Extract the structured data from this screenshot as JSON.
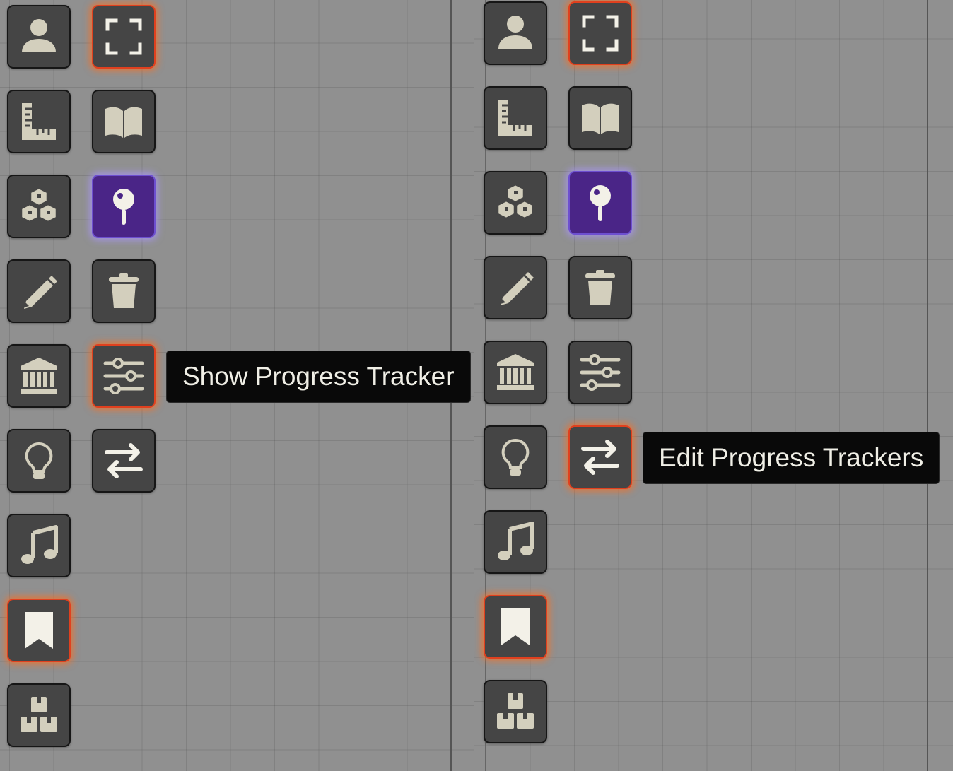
{
  "colors": {
    "canvas": "#909090",
    "button_bg": "#454545",
    "icon": "#d3cfbd",
    "active_glow": "#ff6e1e",
    "active_border": "#e0401e",
    "selected_bg": "#4a2587",
    "selected_glow": "#aa96ff",
    "tooltip_bg": "#090909",
    "tooltip_text": "#f0efe6"
  },
  "panels": [
    {
      "id": "left",
      "tools": [
        {
          "name": "token-controls-button",
          "icon": "user-icon",
          "state": "normal"
        },
        {
          "name": "toggle-fullscreen-button",
          "icon": "expand-icon",
          "state": "active"
        },
        {
          "name": "measurement-controls-button",
          "icon": "ruler-icon",
          "state": "normal"
        },
        {
          "name": "journal-notes-button",
          "icon": "book-open-icon",
          "state": "normal"
        },
        {
          "name": "tile-controls-button",
          "icon": "cubes-icon",
          "state": "normal"
        },
        {
          "name": "map-pin-button",
          "icon": "map-pin-icon",
          "state": "selected"
        },
        {
          "name": "drawing-tools-button",
          "icon": "pencil-icon",
          "state": "normal"
        },
        {
          "name": "delete-button",
          "icon": "trash-icon",
          "state": "normal"
        },
        {
          "name": "scene-building-button",
          "icon": "landmark-icon",
          "state": "normal"
        },
        {
          "name": "show-progress-tracker-button",
          "icon": "sliders-icon",
          "state": "active"
        },
        {
          "name": "lighting-controls-button",
          "icon": "lightbulb-icon",
          "state": "normal"
        },
        {
          "name": "edit-progress-trackers-button",
          "icon": "swap-arrows-icon",
          "state": "normal"
        },
        {
          "name": "ambient-sound-button",
          "icon": "music-note-icon",
          "state": "normal"
        },
        {
          "name": "bookmark-button",
          "icon": "bookmark-icon",
          "state": "active"
        },
        {
          "name": "boxes-button",
          "icon": "boxes-icon",
          "state": "normal"
        }
      ],
      "tooltip": "Show Progress Tracker"
    },
    {
      "id": "right",
      "tools": [
        {
          "name": "token-controls-button",
          "icon": "user-icon",
          "state": "normal"
        },
        {
          "name": "toggle-fullscreen-button",
          "icon": "expand-icon",
          "state": "active"
        },
        {
          "name": "measurement-controls-button",
          "icon": "ruler-icon",
          "state": "normal"
        },
        {
          "name": "journal-notes-button",
          "icon": "book-open-icon",
          "state": "normal"
        },
        {
          "name": "tile-controls-button",
          "icon": "cubes-icon",
          "state": "normal"
        },
        {
          "name": "map-pin-button",
          "icon": "map-pin-icon",
          "state": "selected"
        },
        {
          "name": "drawing-tools-button",
          "icon": "pencil-icon",
          "state": "normal"
        },
        {
          "name": "delete-button",
          "icon": "trash-icon",
          "state": "normal"
        },
        {
          "name": "scene-building-button",
          "icon": "landmark-icon",
          "state": "normal"
        },
        {
          "name": "show-progress-tracker-button",
          "icon": "sliders-icon",
          "state": "normal"
        },
        {
          "name": "lighting-controls-button",
          "icon": "lightbulb-icon",
          "state": "normal"
        },
        {
          "name": "edit-progress-trackers-button",
          "icon": "swap-arrows-icon",
          "state": "active"
        },
        {
          "name": "ambient-sound-button",
          "icon": "music-note-icon",
          "state": "normal"
        },
        {
          "name": "bookmark-button",
          "icon": "bookmark-icon",
          "state": "active"
        },
        {
          "name": "boxes-button",
          "icon": "boxes-icon",
          "state": "normal"
        }
      ],
      "tooltip": "Edit Progress Trackers"
    }
  ]
}
